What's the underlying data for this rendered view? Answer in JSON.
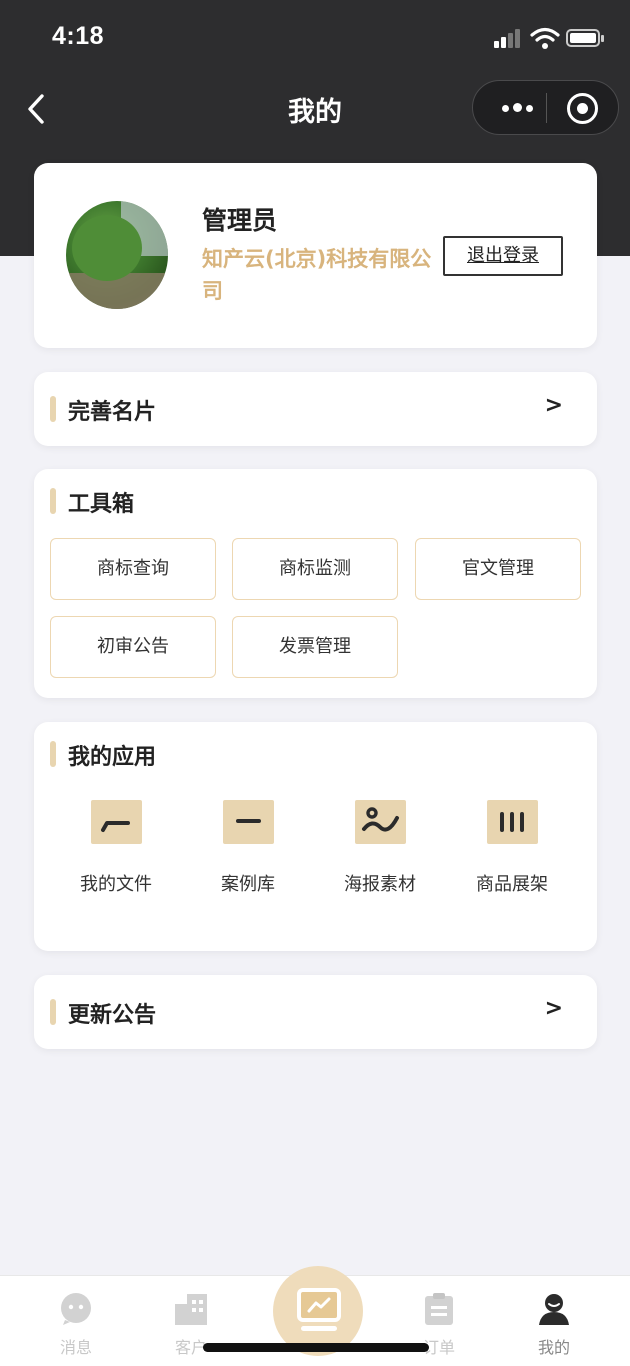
{
  "status_bar": {
    "time": "4:18",
    "icons": [
      "signal-icon",
      "wifi-icon",
      "battery-icon"
    ]
  },
  "nav": {
    "title": "我的",
    "icons": [
      "back-arrow-icon",
      "more-dots-icon",
      "close-target-icon"
    ]
  },
  "profile": {
    "name": "管理员",
    "company": "知产云(北京)科技有限公司",
    "logout_label": "退出登录"
  },
  "business_card": {
    "title": "完善名片",
    "chevron": ">"
  },
  "toolbox": {
    "title": "工具箱",
    "tools": [
      {
        "label": "商标查询"
      },
      {
        "label": "商标监测"
      },
      {
        "label": "官文管理"
      },
      {
        "label": "初审公告"
      },
      {
        "label": "发票管理"
      }
    ]
  },
  "apps": {
    "title": "我的应用",
    "items": [
      {
        "label": "我的文件",
        "icon": "file-curve-icon"
      },
      {
        "label": "案例库",
        "icon": "case-dash-icon"
      },
      {
        "label": "海报素材",
        "icon": "poster-wave-icon"
      },
      {
        "label": "商品展架",
        "icon": "shelf-bars-icon"
      }
    ]
  },
  "updates": {
    "title": "更新公告",
    "chevron": ">"
  },
  "tabbar": {
    "tabs": [
      {
        "label": "消息",
        "icon": "message-bubble-icon"
      },
      {
        "label": "客户",
        "icon": "building-icon"
      },
      {
        "label": "订单",
        "icon": "clipboard-icon"
      },
      {
        "label": "我的",
        "icon": "user-icon",
        "active": true
      }
    ],
    "center_icon": "board-chart-icon"
  },
  "colors": {
    "accent": "#d8b47d",
    "accent_light": "#e8d5b0",
    "header_bg": "#2d2d2f",
    "page_bg": "#f2f2f7"
  }
}
